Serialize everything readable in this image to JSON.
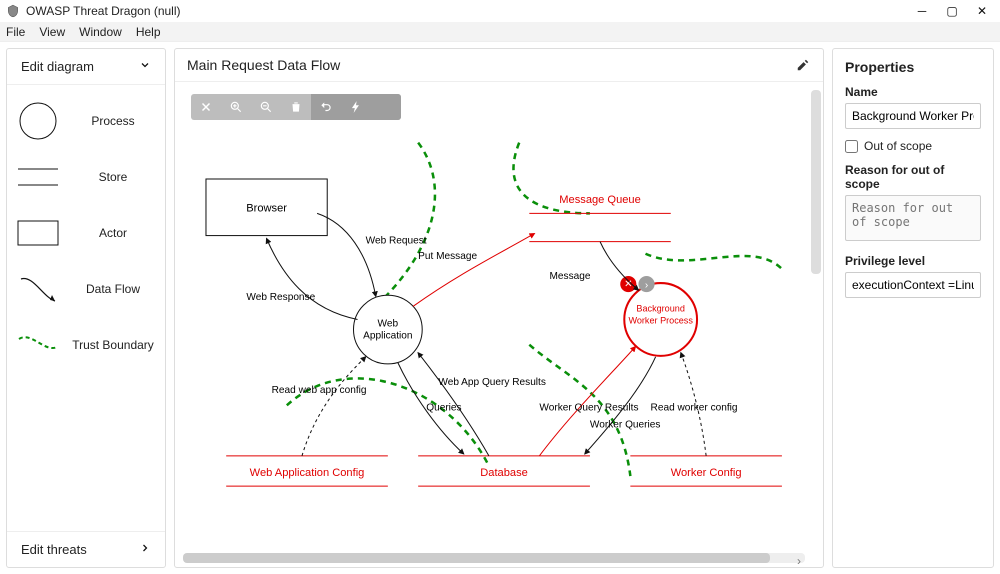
{
  "window": {
    "title": "OWASP Threat Dragon (null)"
  },
  "menu": {
    "file": "File",
    "view": "View",
    "window": "Window",
    "help": "Help"
  },
  "left": {
    "edit_diagram": "Edit diagram",
    "stencils": {
      "process": "Process",
      "store": "Store",
      "actor": "Actor",
      "data_flow": "Data Flow",
      "trust_boundary": "Trust Boundary"
    },
    "edit_threats": "Edit threats"
  },
  "canvas": {
    "title": "Main Request Data Flow",
    "nodes": {
      "browser": "Browser",
      "web_application": "Web Application",
      "message_queue": "Message Queue",
      "background_worker": "Background Worker Process",
      "web_app_config": "Web Application Config",
      "database": "Database",
      "worker_config": "Worker Config"
    },
    "flows": {
      "web_request": "Web Request",
      "web_response": "Web Response",
      "put_message": "Put Message",
      "message": "Message",
      "read_web_app_config": "Read web app config",
      "queries": "Queries",
      "web_app_query_results": "Web App Query Results",
      "worker_query_results": "Worker Query Results",
      "worker_queries": "Worker Queries",
      "read_worker_config": "Read worker config"
    }
  },
  "props": {
    "header": "Properties",
    "name_label": "Name",
    "name_value": "Background Worker Process",
    "out_of_scope_label": "Out of scope",
    "reason_label": "Reason for out of scope",
    "reason_placeholder": "Reason for out of scope",
    "priv_label": "Privilege level",
    "priv_value": "executionContext =Linux"
  }
}
